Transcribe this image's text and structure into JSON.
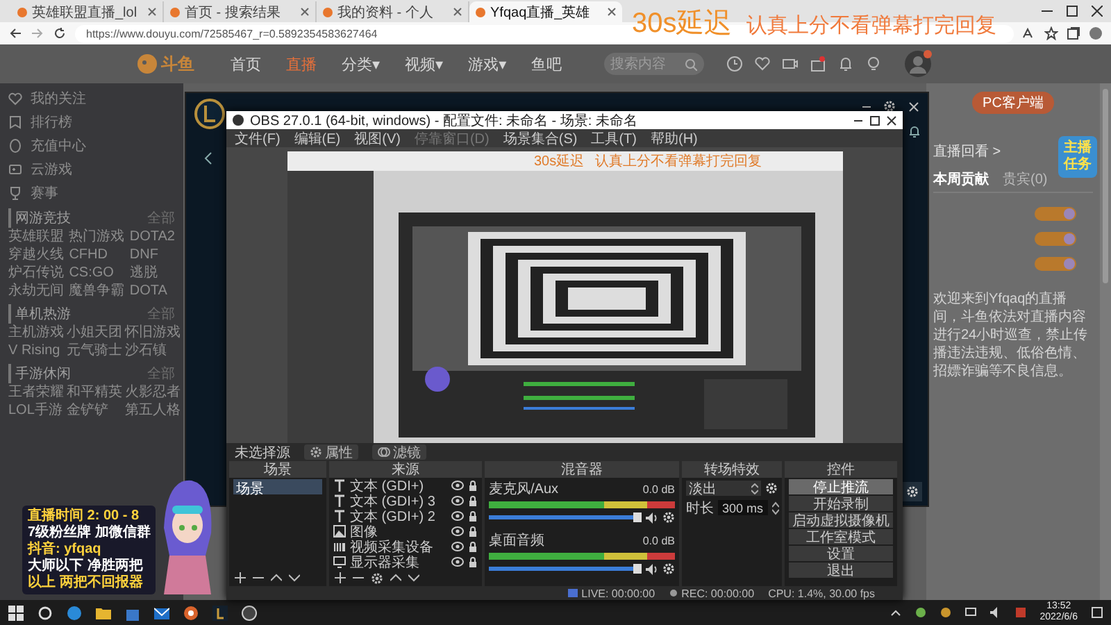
{
  "browser": {
    "tabs": [
      {
        "title": "英雄联盟直播_lol",
        "selected": false
      },
      {
        "title": "首页 - 搜索结果",
        "selected": false
      },
      {
        "title": "我的资料 - 个人",
        "selected": false
      },
      {
        "title": "Yfqaq直播_英雄",
        "selected": true
      }
    ],
    "address": "https://www.douyu.com/72585467_r=0.5892354583627464"
  },
  "stream_overlay": {
    "delay": "30s延迟",
    "notice": "认真上分不看弹幕打完回复"
  },
  "site_header": {
    "logo": "斗鱼",
    "nav": [
      {
        "label": "首页",
        "selected": false
      },
      {
        "label": "直播",
        "selected": true
      },
      {
        "label": "分类▾",
        "selected": false
      },
      {
        "label": "视频▾",
        "selected": false
      },
      {
        "label": "游戏▾",
        "selected": false
      },
      {
        "label": "鱼吧",
        "selected": false
      }
    ],
    "search_placeholder": "搜索内容"
  },
  "sidebar": {
    "items": [
      {
        "label": "我的关注",
        "kind": "heart"
      },
      {
        "label": "排行榜",
        "kind": "rank"
      },
      {
        "label": "充值中心",
        "kind": "coin"
      },
      {
        "label": "云游戏",
        "kind": "gamepad"
      },
      {
        "label": "赛事",
        "kind": "trophy"
      }
    ],
    "sections": [
      {
        "title": "网游竞技",
        "more": "全部",
        "games": [
          "英雄联盟",
          "热门游戏",
          "DOTA2",
          "穿越火线",
          "CFHD",
          "DNF",
          "炉石传说",
          "CS:GO",
          "逃脱",
          "永劫无间",
          "魔兽争霸",
          "DOTA"
        ]
      },
      {
        "title": "单机热游",
        "more": "全部",
        "games": [
          "主机游戏",
          "小姐天团",
          "怀旧游戏",
          "V Rising",
          "元气骑士",
          "沙石镇"
        ]
      },
      {
        "title": "手游休闲",
        "more": "全部",
        "games": [
          "王者荣耀",
          "和平精英",
          "火影忍者",
          "LOL手游",
          "金铲铲",
          "第五人格"
        ]
      }
    ]
  },
  "right_panel": {
    "client_button": "PC客户端",
    "replay_link": "直播回看 >",
    "tabs": [
      {
        "label": "本周贡献",
        "selected": true
      },
      {
        "label": "贵宾(0)",
        "selected": false
      }
    ],
    "task_badge": "主播任务",
    "notice": "欢迎来到Yfqaq的直播间，斗鱼依法对直播内容进行24小时巡查，禁止传播违法违规、低俗色情、招嫖诈骗等不良信息。"
  },
  "obs": {
    "title": "OBS 27.0.1 (64-bit, windows) - 配置文件: 未命名 - 场景: 未命名",
    "menu": [
      {
        "label": "文件(F)",
        "disabled": false
      },
      {
        "label": "编辑(E)",
        "disabled": false
      },
      {
        "label": "视图(V)",
        "disabled": false
      },
      {
        "label": "停靠窗口(D)",
        "disabled": true
      },
      {
        "label": "场景集合(S)",
        "disabled": false
      },
      {
        "label": "工具(T)",
        "disabled": false
      },
      {
        "label": "帮助(H)",
        "disabled": false
      }
    ],
    "preview": {
      "delay": "30s延迟",
      "notice": "认真上分不看弹幕打完回复"
    },
    "source_bar": {
      "label": "未选择源",
      "buttons": [
        {
          "label": "属性",
          "kind": "gear"
        },
        {
          "label": "滤镜",
          "kind": "filter"
        }
      ]
    },
    "scenes": {
      "title": "场景",
      "items": [
        {
          "label": "场景",
          "selected": true
        }
      ]
    },
    "sources": {
      "title": "来源",
      "items": [
        {
          "label": "文本 (GDI+)",
          "kind": "text"
        },
        {
          "label": "文本 (GDI+) 3",
          "kind": "text"
        },
        {
          "label": "文本 (GDI+) 2",
          "kind": "text"
        },
        {
          "label": "图像",
          "kind": "image"
        },
        {
          "label": "视频采集设备",
          "kind": "camera"
        },
        {
          "label": "显示器采集",
          "kind": "display"
        }
      ]
    },
    "mixer": {
      "title": "混音器",
      "channels": [
        {
          "name": "麦克风/Aux",
          "reading": "0.0 dB",
          "level": 1
        },
        {
          "name": "桌面音频",
          "reading": "0.0 dB",
          "level": 1
        }
      ]
    },
    "transitions": {
      "title": "转场特效",
      "transition": "淡出",
      "duration_label": "时长",
      "duration": "300 ms"
    },
    "controls": {
      "title": "控件",
      "buttons": [
        {
          "label": "停止推流",
          "active": true
        },
        {
          "label": "开始录制",
          "active": false
        },
        {
          "label": "启动虚拟摄像机",
          "active": false
        },
        {
          "label": "工作室模式",
          "active": false
        },
        {
          "label": "设置",
          "active": false
        },
        {
          "label": "退出",
          "active": false
        }
      ]
    },
    "status": {
      "live": "LIVE: 00:00:00",
      "rec": "REC: 00:00:00",
      "cpu": "CPU: 1.4%, 30.00 fps"
    }
  },
  "sticker": {
    "lines": [
      "直播时间 2: 00 - 8",
      "7级粉丝牌 加微信群",
      "抖音: yfqaq",
      "大师以下 净胜两把",
      "以上 两把不回报器"
    ]
  },
  "taskbar": {
    "time": "13:52",
    "date": "2022/6/6"
  }
}
